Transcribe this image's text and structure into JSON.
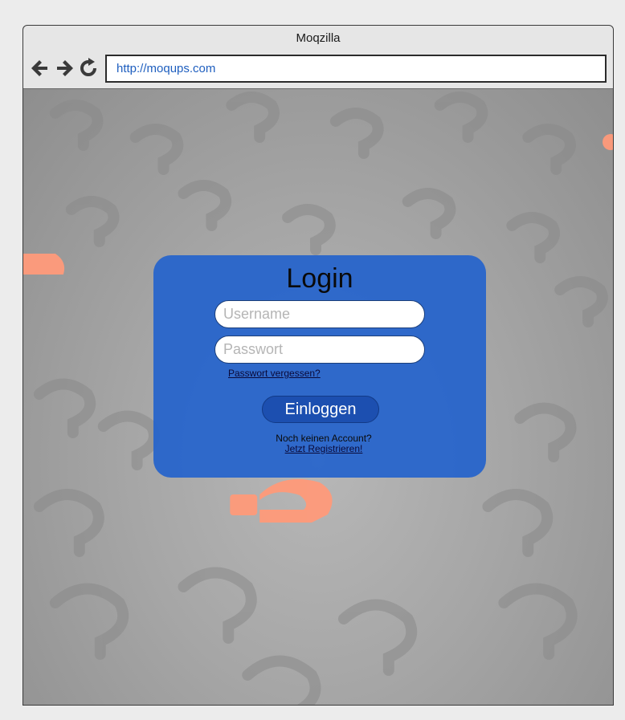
{
  "window": {
    "title": "Moqzilla"
  },
  "toolbar": {
    "back_icon": "arrow-left-icon",
    "forward_icon": "arrow-right-icon",
    "reload_icon": "reload-icon",
    "url": "http://moqups.com"
  },
  "login": {
    "title": "Login",
    "username_placeholder": "Username",
    "password_placeholder": "Passwort",
    "forgot_link": "Passwort vergessen?",
    "submit_label": "Einloggen",
    "no_account_text": "Noch keinen Account?",
    "register_link": "Jetzt Registrieren!"
  },
  "colors": {
    "panel": "#2463cc",
    "button": "#1c4fb0",
    "url_text": "#1f5fbf",
    "accent_question_mark": "#ff8a6a"
  }
}
